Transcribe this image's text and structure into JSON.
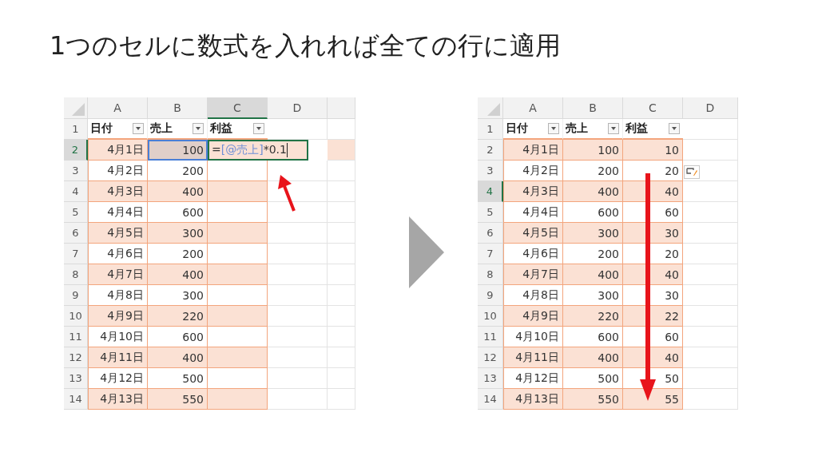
{
  "title": "1つのセルに数式を入れれば全ての行に適用",
  "sheets": [
    {
      "columns": [
        {
          "label": "A",
          "selected": false
        },
        {
          "label": "B",
          "selected": false
        },
        {
          "label": "C",
          "selected": true
        },
        {
          "label": "D",
          "selected": false
        }
      ],
      "header": {
        "number": "1",
        "selected": false,
        "cells": [
          "日付",
          "売上",
          "利益"
        ]
      },
      "rows": [
        {
          "number": "2",
          "selected": true,
          "cells": [
            {
              "kind": "value",
              "text": "4月1日"
            },
            {
              "kind": "reference",
              "text": "100"
            },
            {
              "kind": "formula",
              "prefix": "=",
              "ref": "[@売上]",
              "suffix": "*0.1"
            }
          ]
        },
        {
          "number": "3",
          "selected": false,
          "cells": [
            {
              "kind": "value",
              "text": "4月2日"
            },
            {
              "kind": "value",
              "text": "200"
            },
            {
              "kind": "empty"
            }
          ]
        },
        {
          "number": "4",
          "selected": false,
          "cells": [
            {
              "kind": "value",
              "text": "4月3日"
            },
            {
              "kind": "value",
              "text": "400"
            },
            {
              "kind": "empty"
            }
          ]
        },
        {
          "number": "5",
          "selected": false,
          "cells": [
            {
              "kind": "value",
              "text": "4月4日"
            },
            {
              "kind": "value",
              "text": "600"
            },
            {
              "kind": "empty"
            }
          ]
        },
        {
          "number": "6",
          "selected": false,
          "cells": [
            {
              "kind": "value",
              "text": "4月5日"
            },
            {
              "kind": "value",
              "text": "300"
            },
            {
              "kind": "empty"
            }
          ]
        },
        {
          "number": "7",
          "selected": false,
          "cells": [
            {
              "kind": "value",
              "text": "4月6日"
            },
            {
              "kind": "value",
              "text": "200"
            },
            {
              "kind": "empty"
            }
          ]
        },
        {
          "number": "8",
          "selected": false,
          "cells": [
            {
              "kind": "value",
              "text": "4月7日"
            },
            {
              "kind": "value",
              "text": "400"
            },
            {
              "kind": "empty"
            }
          ]
        },
        {
          "number": "9",
          "selected": false,
          "cells": [
            {
              "kind": "value",
              "text": "4月8日"
            },
            {
              "kind": "value",
              "text": "300"
            },
            {
              "kind": "empty"
            }
          ]
        },
        {
          "number": "10",
          "selected": false,
          "cells": [
            {
              "kind": "value",
              "text": "4月9日"
            },
            {
              "kind": "value",
              "text": "220"
            },
            {
              "kind": "empty"
            }
          ]
        },
        {
          "number": "11",
          "selected": false,
          "cells": [
            {
              "kind": "value",
              "text": "4月10日"
            },
            {
              "kind": "value",
              "text": "600"
            },
            {
              "kind": "empty"
            }
          ]
        },
        {
          "number": "12",
          "selected": false,
          "cells": [
            {
              "kind": "value",
              "text": "4月11日"
            },
            {
              "kind": "value",
              "text": "400"
            },
            {
              "kind": "empty"
            }
          ]
        },
        {
          "number": "13",
          "selected": false,
          "cells": [
            {
              "kind": "value",
              "text": "4月12日"
            },
            {
              "kind": "value",
              "text": "500"
            },
            {
              "kind": "empty"
            }
          ]
        },
        {
          "number": "14",
          "selected": false,
          "cells": [
            {
              "kind": "value",
              "text": "4月13日"
            },
            {
              "kind": "value",
              "text": "550"
            },
            {
              "kind": "empty"
            }
          ]
        }
      ],
      "overlays": [
        {
          "kind": "up_arrow"
        }
      ]
    },
    {
      "columns": [
        {
          "label": "A",
          "selected": false
        },
        {
          "label": "B",
          "selected": false
        },
        {
          "label": "C",
          "selected": false
        },
        {
          "label": "D",
          "selected": false
        }
      ],
      "header": {
        "number": "1",
        "selected": false,
        "cells": [
          "日付",
          "売上",
          "利益"
        ]
      },
      "rows": [
        {
          "number": "2",
          "selected": false,
          "cells": [
            {
              "kind": "value",
              "text": "4月1日"
            },
            {
              "kind": "value",
              "text": "100"
            },
            {
              "kind": "value",
              "text": "10"
            }
          ]
        },
        {
          "number": "3",
          "selected": false,
          "cells": [
            {
              "kind": "value",
              "text": "4月2日"
            },
            {
              "kind": "value",
              "text": "200"
            },
            {
              "kind": "value",
              "text": "20"
            }
          ]
        },
        {
          "number": "4",
          "selected": true,
          "cells": [
            {
              "kind": "value",
              "text": "4月3日"
            },
            {
              "kind": "value",
              "text": "400"
            },
            {
              "kind": "value",
              "text": "40"
            }
          ]
        },
        {
          "number": "5",
          "selected": false,
          "cells": [
            {
              "kind": "value",
              "text": "4月4日"
            },
            {
              "kind": "value",
              "text": "600"
            },
            {
              "kind": "value",
              "text": "60"
            }
          ]
        },
        {
          "number": "6",
          "selected": false,
          "cells": [
            {
              "kind": "value",
              "text": "4月5日"
            },
            {
              "kind": "value",
              "text": "300"
            },
            {
              "kind": "value",
              "text": "30"
            }
          ]
        },
        {
          "number": "7",
          "selected": false,
          "cells": [
            {
              "kind": "value",
              "text": "4月6日"
            },
            {
              "kind": "value",
              "text": "200"
            },
            {
              "kind": "value",
              "text": "20"
            }
          ]
        },
        {
          "number": "8",
          "selected": false,
          "cells": [
            {
              "kind": "value",
              "text": "4月7日"
            },
            {
              "kind": "value",
              "text": "400"
            },
            {
              "kind": "value",
              "text": "40"
            }
          ]
        },
        {
          "number": "9",
          "selected": false,
          "cells": [
            {
              "kind": "value",
              "text": "4月8日"
            },
            {
              "kind": "value",
              "text": "300"
            },
            {
              "kind": "value",
              "text": "30"
            }
          ]
        },
        {
          "number": "10",
          "selected": false,
          "cells": [
            {
              "kind": "value",
              "text": "4月9日"
            },
            {
              "kind": "value",
              "text": "220"
            },
            {
              "kind": "value",
              "text": "22"
            }
          ]
        },
        {
          "number": "11",
          "selected": false,
          "cells": [
            {
              "kind": "value",
              "text": "4月10日"
            },
            {
              "kind": "value",
              "text": "600"
            },
            {
              "kind": "value",
              "text": "60"
            }
          ]
        },
        {
          "number": "12",
          "selected": false,
          "cells": [
            {
              "kind": "value",
              "text": "4月11日"
            },
            {
              "kind": "value",
              "text": "400"
            },
            {
              "kind": "value",
              "text": "40"
            }
          ]
        },
        {
          "number": "13",
          "selected": false,
          "cells": [
            {
              "kind": "value",
              "text": "4月12日"
            },
            {
              "kind": "value",
              "text": "500"
            },
            {
              "kind": "value",
              "text": "50"
            }
          ]
        },
        {
          "number": "14",
          "selected": false,
          "cells": [
            {
              "kind": "value",
              "text": "4月13日"
            },
            {
              "kind": "value",
              "text": "550"
            },
            {
              "kind": "value",
              "text": "55"
            }
          ]
        }
      ],
      "overlays": [
        {
          "kind": "autofill_button"
        },
        {
          "kind": "down_arrow"
        }
      ]
    }
  ]
}
